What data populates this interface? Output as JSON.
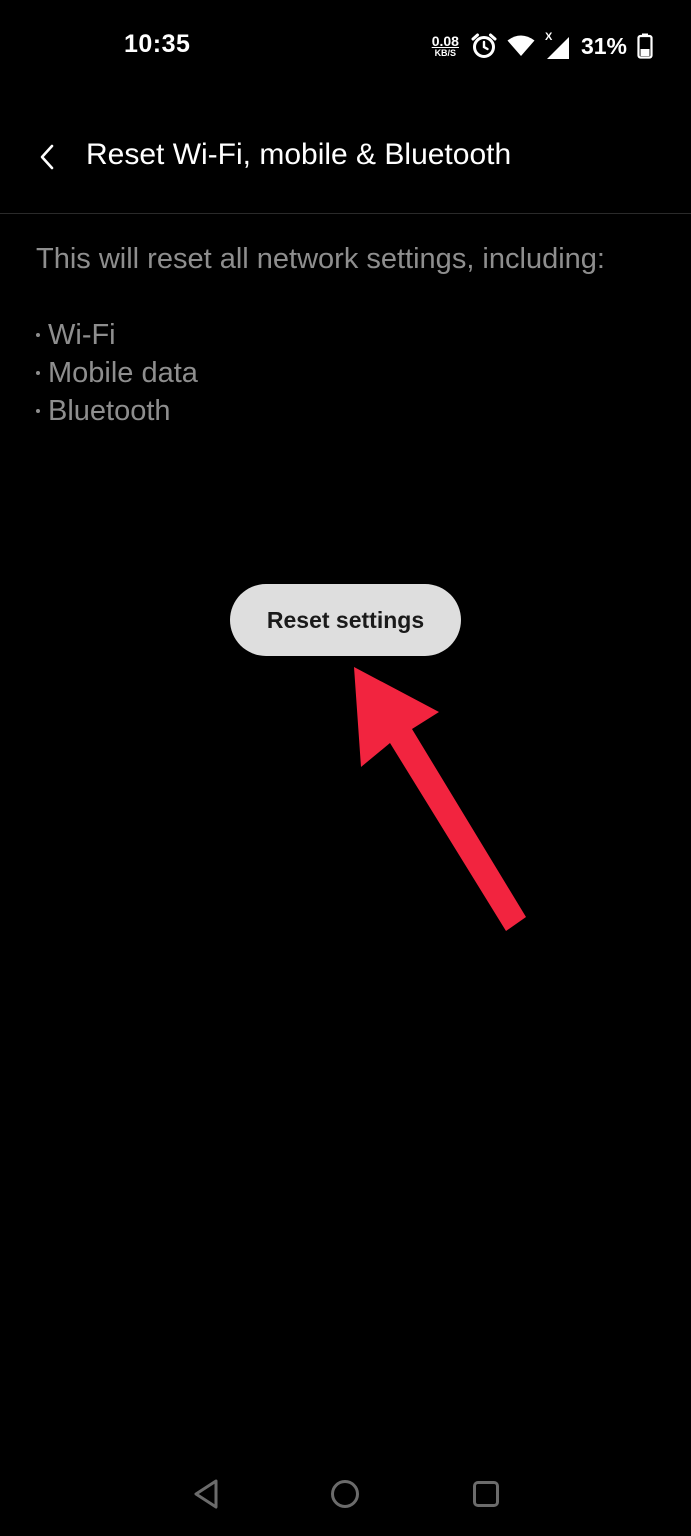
{
  "status_bar": {
    "time": "10:35",
    "net_speed_value": "0.08",
    "net_speed_unit": "KB/S",
    "battery_percent": "31%",
    "icons": [
      "alarm-icon",
      "wifi-icon",
      "cellular-no-data-icon",
      "battery-icon"
    ]
  },
  "header": {
    "back_icon": "chevron-left-icon",
    "title": "Reset Wi-Fi, mobile & Bluetooth"
  },
  "content": {
    "description": "This will reset all network settings, including:",
    "items": [
      {
        "label": "Wi-Fi"
      },
      {
        "label": "Mobile data"
      },
      {
        "label": "Bluetooth"
      }
    ]
  },
  "actions": {
    "reset_label": "Reset settings"
  },
  "annotation": {
    "arrow_color": "#f2243f"
  },
  "nav_bar": {
    "icons": [
      "nav-back-icon",
      "nav-home-icon",
      "nav-recents-icon"
    ]
  },
  "colors": {
    "background": "#000000",
    "text_primary": "#ffffff",
    "text_secondary": "#8e8e8e",
    "button_bg": "#dedede",
    "button_text": "#1a1a1a"
  }
}
